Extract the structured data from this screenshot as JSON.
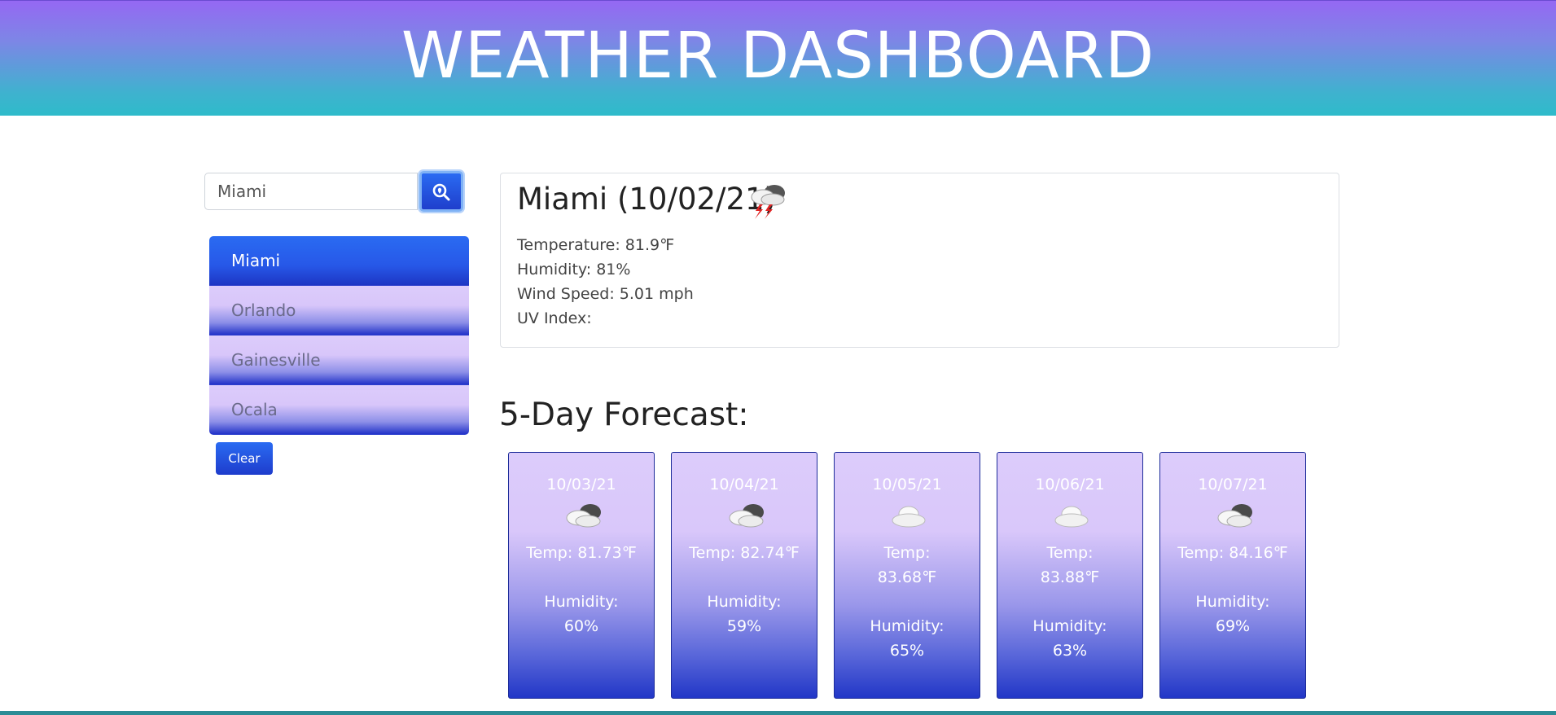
{
  "header": {
    "title": "WEATHER DASHBOARD"
  },
  "search": {
    "value": "Miami",
    "button_icon": "search-location-icon"
  },
  "history": [
    {
      "label": "Miami",
      "active": true
    },
    {
      "label": "Orlando",
      "active": false
    },
    {
      "label": "Gainesville",
      "active": false
    },
    {
      "label": "Ocala",
      "active": false
    }
  ],
  "clear_label": "Clear",
  "current": {
    "title": "Miami (10/02/21)",
    "icon": "thunderstorm-icon",
    "temperature": "Temperature: 81.9℉",
    "humidity": "Humidity: 81%",
    "wind": "Wind Speed: 5.01 mph",
    "uv": "UV Index:"
  },
  "forecast_heading": "5-Day Forecast:",
  "forecast": [
    {
      "date": "10/03/21",
      "icon": "cloudy-icon",
      "temp_lines": [
        "Temp: 81.73℉"
      ],
      "hum_lines": [
        "Humidity:",
        "60%"
      ]
    },
    {
      "date": "10/04/21",
      "icon": "cloudy-icon",
      "temp_lines": [
        "Temp: 82.74℉"
      ],
      "hum_lines": [
        "Humidity:",
        "59%"
      ]
    },
    {
      "date": "10/05/21",
      "icon": "cloud-icon",
      "temp_lines": [
        "Temp:",
        "83.68℉"
      ],
      "hum_lines": [
        "Humidity:",
        "65%"
      ]
    },
    {
      "date": "10/06/21",
      "icon": "cloud-icon",
      "temp_lines": [
        "Temp:",
        "83.88℉"
      ],
      "hum_lines": [
        "Humidity:",
        "63%"
      ]
    },
    {
      "date": "10/07/21",
      "icon": "cloudy-icon",
      "temp_lines": [
        "Temp: 84.16℉"
      ],
      "hum_lines": [
        "Humidity:",
        "69%"
      ]
    }
  ],
  "colors": {
    "accent": "#2a6bf2",
    "header_top": "#9568f3",
    "header_bottom": "#2ebbca"
  }
}
